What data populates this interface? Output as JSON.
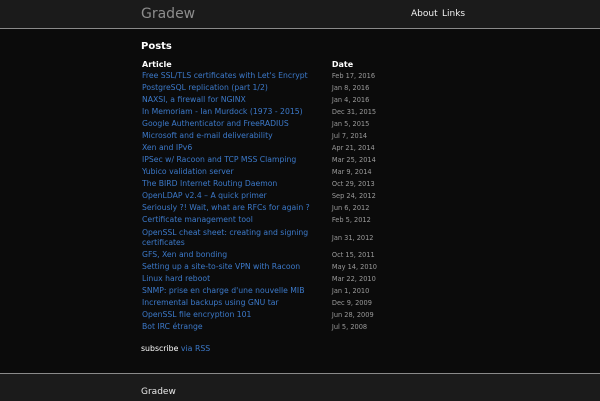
{
  "header": {
    "site_name": "Gradew",
    "nav": [
      "About",
      "Links"
    ]
  },
  "main": {
    "title": "Posts",
    "columns": [
      "Article",
      "Date"
    ],
    "posts": [
      {
        "title": "Free SSL/TLS certificates with Let's Encrypt",
        "date": "Feb 17, 2016"
      },
      {
        "title": "PostgreSQL replication (part 1/2)",
        "date": "Jan 8, 2016"
      },
      {
        "title": "NAXSI, a firewall for NGINX",
        "date": "Jan 4, 2016"
      },
      {
        "title": "In Memoriam - Ian Murdock (1973 - 2015)",
        "date": "Dec 31, 2015"
      },
      {
        "title": "Google Authenticator and FreeRADIUS",
        "date": "Jan 5, 2015"
      },
      {
        "title": "Microsoft and e-mail deliverability",
        "date": "Jul 7, 2014"
      },
      {
        "title": "Xen and IPv6",
        "date": "Apr 21, 2014"
      },
      {
        "title": "IPSec w/ Racoon and TCP MSS Clamping",
        "date": "Mar 25, 2014"
      },
      {
        "title": "Yubico validation server",
        "date": "Mar 9, 2014"
      },
      {
        "title": "The BIRD Internet Routing Daemon",
        "date": "Oct 29, 2013"
      },
      {
        "title": "OpenLDAP v2.4 – A quick primer",
        "date": "Sep 24, 2012"
      },
      {
        "title": "Seriously ?! Wait, what are RFCs for again ?",
        "date": "Jun 6, 2012"
      },
      {
        "title": "Certificate management tool",
        "date": "Feb 5, 2012"
      },
      {
        "title": "OpenSSL cheat sheet: creating and signing certificates",
        "date": "Jan 31, 2012"
      },
      {
        "title": "GFS, Xen and bonding",
        "date": "Oct 15, 2011"
      },
      {
        "title": "Setting up a site-to-site VPN with Racoon",
        "date": "May 14, 2010"
      },
      {
        "title": "Linux hard reboot",
        "date": "Mar 22, 2010"
      },
      {
        "title": "SNMP: prise en charge d'une nouvelle MIB",
        "date": "Jan 1, 2010"
      },
      {
        "title": "Incremental backups using GNU tar",
        "date": "Dec 9, 2009"
      },
      {
        "title": "OpenSSL file encryption 101",
        "date": "Jun 28, 2009"
      },
      {
        "title": "Bot IRC étrange",
        "date": "Jul 5, 2008"
      }
    ],
    "subscribe_text": "subscribe",
    "subscribe_link": "via RSS"
  },
  "footer": {
    "site_name": "Gradew"
  }
}
